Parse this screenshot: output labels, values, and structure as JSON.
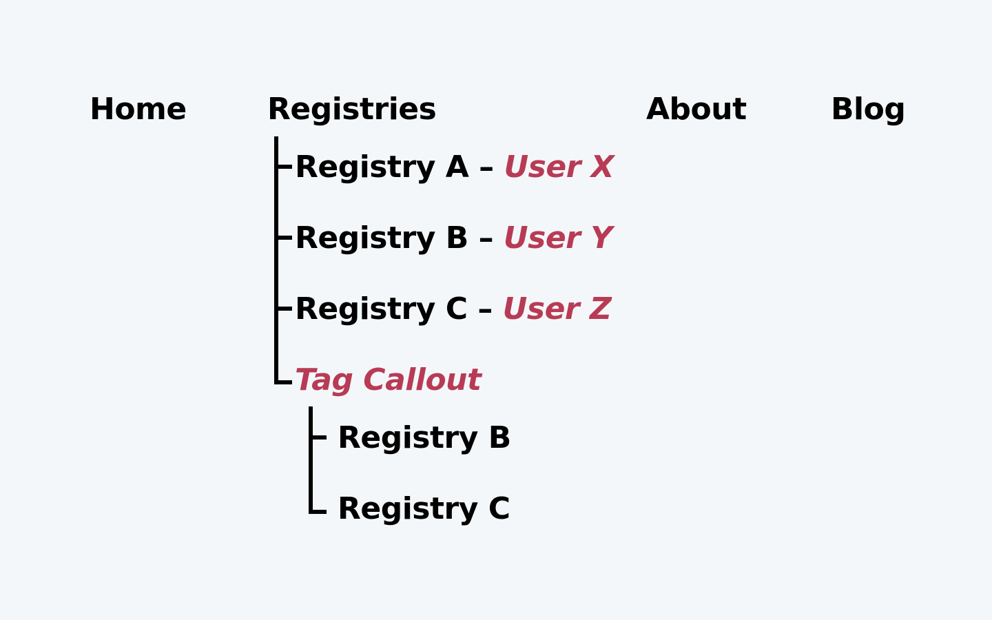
{
  "colors": {
    "background": "#f4f7f9",
    "text": "#000000",
    "accent": "#b83b55"
  },
  "nav": {
    "home": "Home",
    "registries": "Registries",
    "about": "About",
    "blog": "Blog"
  },
  "registries_menu": {
    "items": [
      {
        "label": "Registry A",
        "separator": "–",
        "user": "User X"
      },
      {
        "label": "Registry B",
        "separator": "–",
        "user": "User Y"
      },
      {
        "label": "Registry C",
        "separator": "–",
        "user": "User Z"
      }
    ],
    "tag_callout": {
      "label": "Tag Callout",
      "children": [
        "Registry B",
        "Registry C"
      ]
    }
  }
}
